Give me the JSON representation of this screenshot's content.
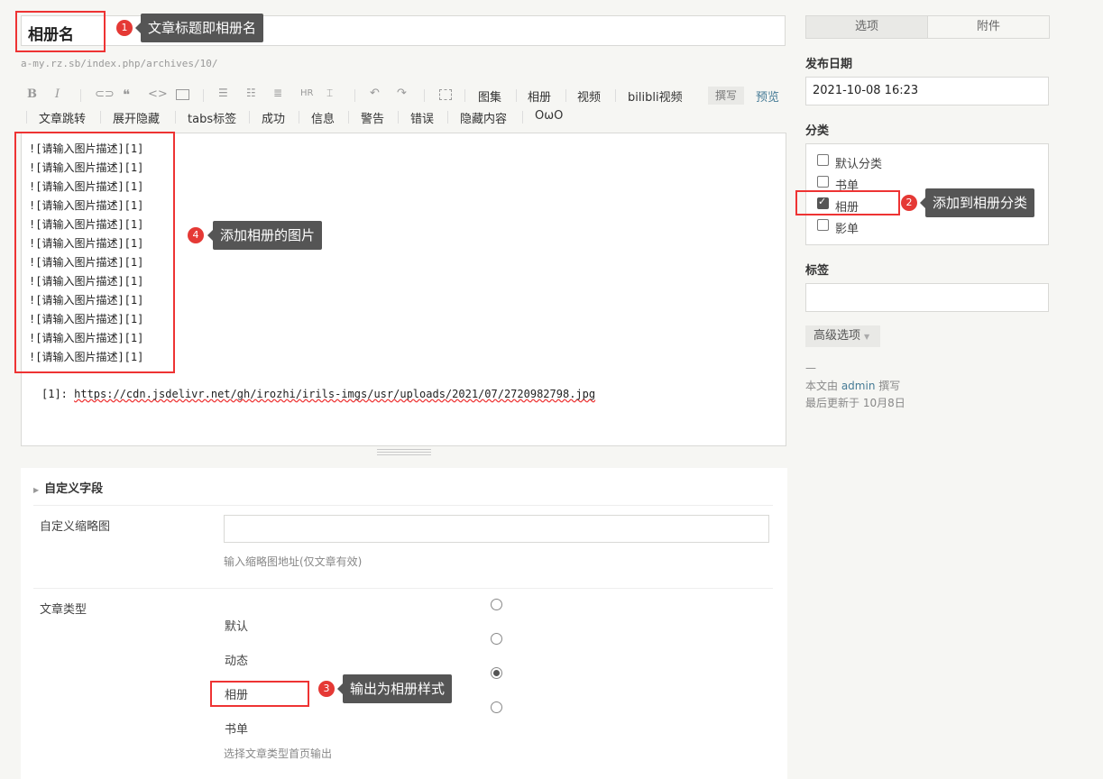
{
  "title": {
    "value": "相册名"
  },
  "url": "a-my.rz.sb/index.php/archives/10/",
  "toolbar": {
    "row1_icons": [
      "B",
      "I",
      "link-icon",
      "quote-icon",
      "code-icon",
      "image-icon",
      "ordered-list-icon",
      "unordered-list-icon",
      "heading-icon",
      "hr-icon",
      "more-icon",
      "undo-icon",
      "redo-icon",
      "fullscreen-icon"
    ],
    "row1_buttons": [
      "图集",
      "相册",
      "视频",
      "bilibli视频"
    ],
    "mode_write": "撰写",
    "mode_preview": "预览",
    "row2_buttons": [
      "文章跳转",
      "展开隐藏",
      "tabs标签",
      "成功",
      "信息",
      "警告",
      "错误",
      "隐藏内容",
      "OωO"
    ]
  },
  "editor": {
    "lines": [
      "![请输入图片描述][1]",
      "![请输入图片描述][1]",
      "![请输入图片描述][1]",
      "![请输入图片描述][1]",
      "![请输入图片描述][1]",
      "![请输入图片描述][1]",
      "![请输入图片描述][1]",
      "![请输入图片描述][1]",
      "![请输入图片描述][1]",
      "![请输入图片描述][1]",
      "![请输入图片描述][1]",
      "![请输入图片描述][1]"
    ],
    "ref_prefix": "[1]: ",
    "ref_url": "https://cdn.jsdelivr.net/gh/irozhi/irils-imgs/usr/uploads/2021/07/2720982798.jpg"
  },
  "custom_fields": {
    "header": "自定义字段",
    "thumb_label": "自定义缩略图",
    "thumb_value": "",
    "thumb_hint": "输入缩略图地址(仅文章有效)",
    "type_label": "文章类型",
    "type_options": [
      "默认",
      "动态",
      "相册",
      "书单"
    ],
    "type_selected": "相册",
    "type_hint": "选择文章类型首页输出"
  },
  "sidebar": {
    "tabs": [
      "选项",
      "附件"
    ],
    "active_tab": "选项",
    "date_label": "发布日期",
    "date_value": "2021-10-08 16:23",
    "category_label": "分类",
    "categories": [
      {
        "name": "默认分类",
        "checked": false
      },
      {
        "name": "书单",
        "checked": false
      },
      {
        "name": "相册",
        "checked": true
      },
      {
        "name": "影单",
        "checked": false
      }
    ],
    "tags_label": "标签",
    "tags_value": "",
    "advanced_label": "高级选项",
    "meta_dash": "—",
    "meta_author_prefix": "本文由 ",
    "meta_author": "admin",
    "meta_author_suffix": " 撰写",
    "meta_updated": "最后更新于 10月8日"
  },
  "annotations": [
    {
      "num": "1",
      "text": "文章标题即相册名"
    },
    {
      "num": "2",
      "text": "添加到相册分类"
    },
    {
      "num": "3",
      "text": "输出为相册样式"
    },
    {
      "num": "4",
      "text": "添加相册的图片"
    }
  ],
  "colors": {
    "accent_link": "#467b96",
    "annotation_red": "#e53935",
    "tooltip_bg": "#555555"
  }
}
